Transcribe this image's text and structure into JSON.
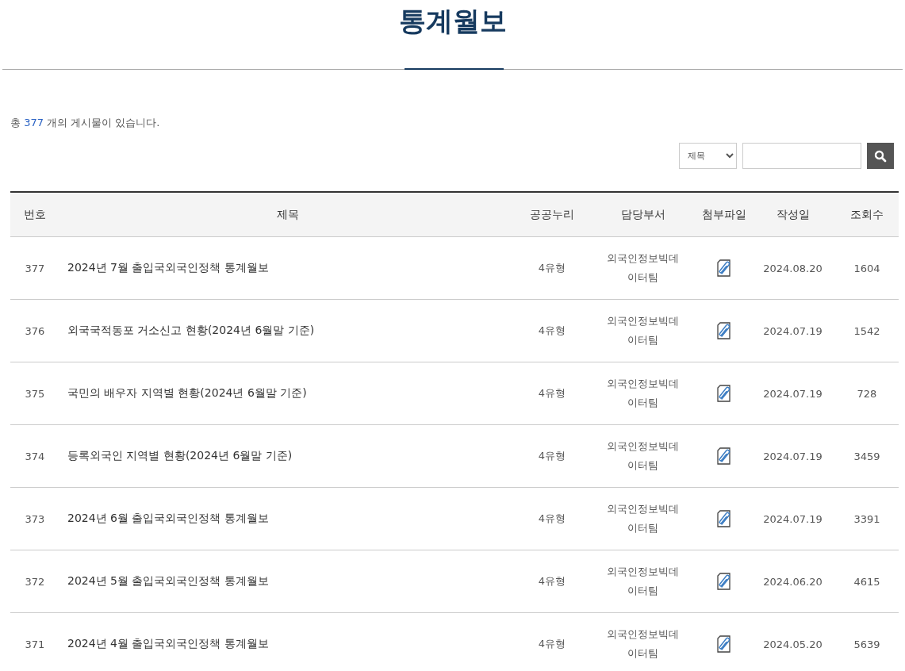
{
  "page_title": "통계월보",
  "summary": {
    "prefix": "총",
    "count": "377",
    "suffix": "개의 게시물이 있습니다."
  },
  "search": {
    "field_select": "제목"
  },
  "table": {
    "columns": [
      "번호",
      "제목",
      "공공누리",
      "담당부서",
      "첨부파일",
      "작성일",
      "조회수"
    ],
    "rows": [
      {
        "number": "377",
        "title": "2024년 7월 출입국외국인정책 통계월보",
        "license": "4유형",
        "department": "외국인정보빅데이터팀",
        "has_attachment": true,
        "date": "2024.08.20",
        "views": "1604"
      },
      {
        "number": "376",
        "title": "외국국적동포 거소신고 현황(2024년 6월말 기준)",
        "license": "4유형",
        "department": "외국인정보빅데이터팀",
        "has_attachment": true,
        "date": "2024.07.19",
        "views": "1542"
      },
      {
        "number": "375",
        "title": "국민의 배우자 지역별 현황(2024년 6월말 기준)",
        "license": "4유형",
        "department": "외국인정보빅데이터팀",
        "has_attachment": true,
        "date": "2024.07.19",
        "views": "728"
      },
      {
        "number": "374",
        "title": "등록외국인 지역별 현황(2024년 6월말 기준)",
        "license": "4유형",
        "department": "외국인정보빅데이터팀",
        "has_attachment": true,
        "date": "2024.07.19",
        "views": "3459"
      },
      {
        "number": "373",
        "title": "2024년 6월 출입국외국인정책 통계월보",
        "license": "4유형",
        "department": "외국인정보빅데이터팀",
        "has_attachment": true,
        "date": "2024.07.19",
        "views": "3391"
      },
      {
        "number": "372",
        "title": "2024년 5월 출입국외국인정책 통계월보",
        "license": "4유형",
        "department": "외국인정보빅데이터팀",
        "has_attachment": true,
        "date": "2024.06.20",
        "views": "4615"
      },
      {
        "number": "371",
        "title": "2024년 4월 출입국외국인정책 통계월보",
        "license": "4유형",
        "department": "외국인정보빅데이터팀",
        "has_attachment": true,
        "date": "2024.05.20",
        "views": "5639"
      }
    ]
  }
}
